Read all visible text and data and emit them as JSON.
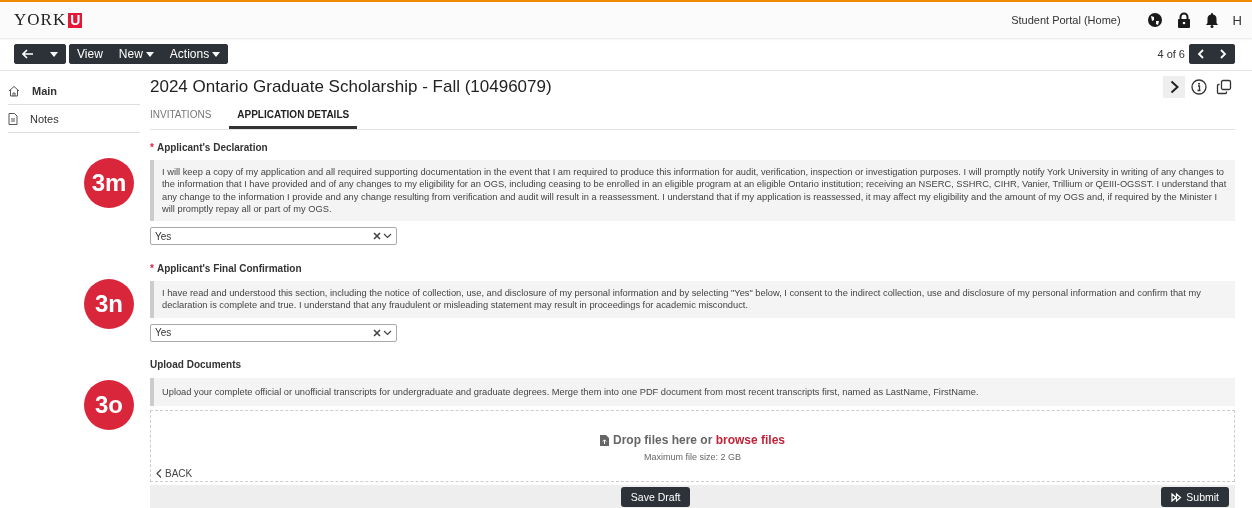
{
  "header": {
    "logo": "YORK",
    "logo_mark": "U",
    "portal_link": "Student Portal (Home)",
    "user_initial": "H"
  },
  "toolbar": {
    "buttons": [
      {
        "label": "View",
        "dropdown": false
      },
      {
        "label": "New",
        "dropdown": true
      },
      {
        "label": "Actions",
        "dropdown": true
      }
    ],
    "pager": "4 of 6"
  },
  "sidebar": {
    "items": [
      {
        "label": "Main",
        "selected": true
      },
      {
        "label": "Notes",
        "selected": false
      }
    ]
  },
  "record": {
    "title": "2024 Ontario Graduate Scholarship - Fall (10496079)",
    "tabs": [
      {
        "label": "INVITATIONS",
        "selected": false
      },
      {
        "label": "APPLICATION DETAILS",
        "selected": true
      }
    ]
  },
  "sections": [
    {
      "kind": "declaration",
      "badge": "3m",
      "required_mark": "*",
      "label": "Applicant's Declaration",
      "text": "I will keep a copy of my application and all required supporting documentation in the event that I am required to produce this information for audit, verification, inspection or investigation purposes. I will promptly notify York University in writing of any changes to the information that I have provided and of any changes to my eligibility for an OGS, including ceasing to be enrolled in an eligible program at an eligible Ontario institution; receiving an NSERC, SSHRC, CIHR, Vanier, Trillium or QEIII-OGSST. I understand that any change to the information I provide and any change resulting from verification and audit will result in a reassessment. I understand that if my application is reassessed, it may affect my eligibility and the amount of my OGS and, if required by the Minister I will promptly repay all or part of my OGS.",
      "answer": "Yes"
    },
    {
      "kind": "declaration",
      "badge": "3n",
      "required_mark": "*",
      "label": "Applicant's Final Confirmation",
      "text": "I have read and understood this section, including the notice of collection, use, and disclosure of my personal information and by selecting \"Yes\" below, I consent to the indirect collection, use and disclosure of my personal information and confirm that my declaration is complete and true. I understand that any fraudulent or misleading statement may result in proceedings for academic misconduct.",
      "answer": "Yes"
    },
    {
      "kind": "upload",
      "badge": "3o",
      "label": "Upload Documents",
      "text": "Upload your complete official or unofficial transcripts for undergraduate and graduate degrees. Merge them into one PDF document from most recent transcripts first, named as LastName, FirstName.",
      "drop_text": "Drop files here or",
      "link": "browse files",
      "max_size": "Maximum file size: 2 GB"
    }
  ],
  "back": "BACK",
  "footer": {
    "save": "Save Draft",
    "submit": "Submit"
  }
}
